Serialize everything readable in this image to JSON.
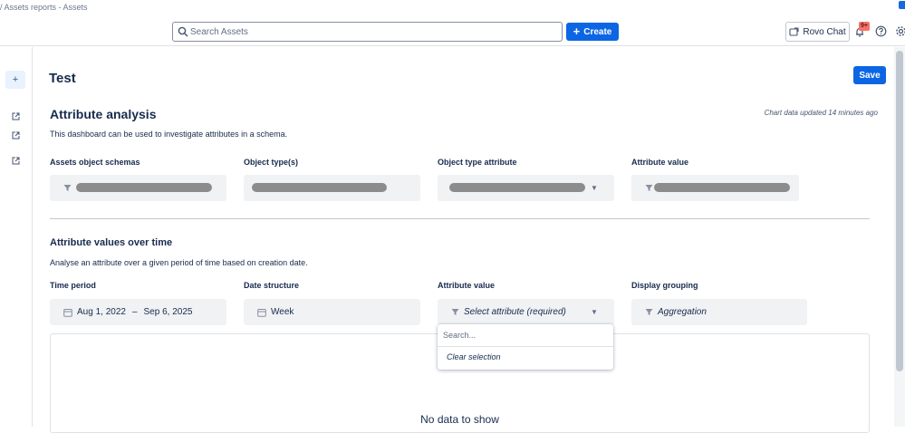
{
  "browser": {
    "tab_title": "/ Assets reports - Assets"
  },
  "topbar": {
    "search_placeholder": "Search Assets",
    "create_label": "Create",
    "rovo_label": "Rovo Chat",
    "notifications_badge": "9+"
  },
  "page": {
    "title": "Test",
    "save_label": "Save"
  },
  "attribute_analysis": {
    "heading": "Attribute analysis",
    "updated_note": "Chart data updated 14 minutes ago",
    "description": "This dashboard can be used to investigate attributes in a schema.",
    "filters": [
      {
        "label": "Assets object schemas"
      },
      {
        "label": "Object type(s)"
      },
      {
        "label": "Object type attribute"
      },
      {
        "label": "Attribute value"
      }
    ]
  },
  "values_over_time": {
    "heading": "Attribute values over time",
    "description": "Analyse an attribute over a given period of time based on creation date.",
    "time_period": {
      "label": "Time period",
      "start": "Aug 1, 2022",
      "separator": "–",
      "end": "Sep 6, 2025"
    },
    "date_structure": {
      "label": "Date structure",
      "value": "Week"
    },
    "attribute_value": {
      "label": "Attribute value",
      "placeholder": "Select attribute (required)"
    },
    "display_grouping": {
      "label": "Display grouping",
      "value": "Aggregation"
    },
    "empty_state": "No data to show"
  },
  "dropdown": {
    "search_placeholder": "Search...",
    "clear_label": "Clear selection"
  },
  "colors": {
    "primary": "#0c66e4",
    "field_bg": "#f1f2f4",
    "text": "#172b4d",
    "badge": "#f87168"
  }
}
